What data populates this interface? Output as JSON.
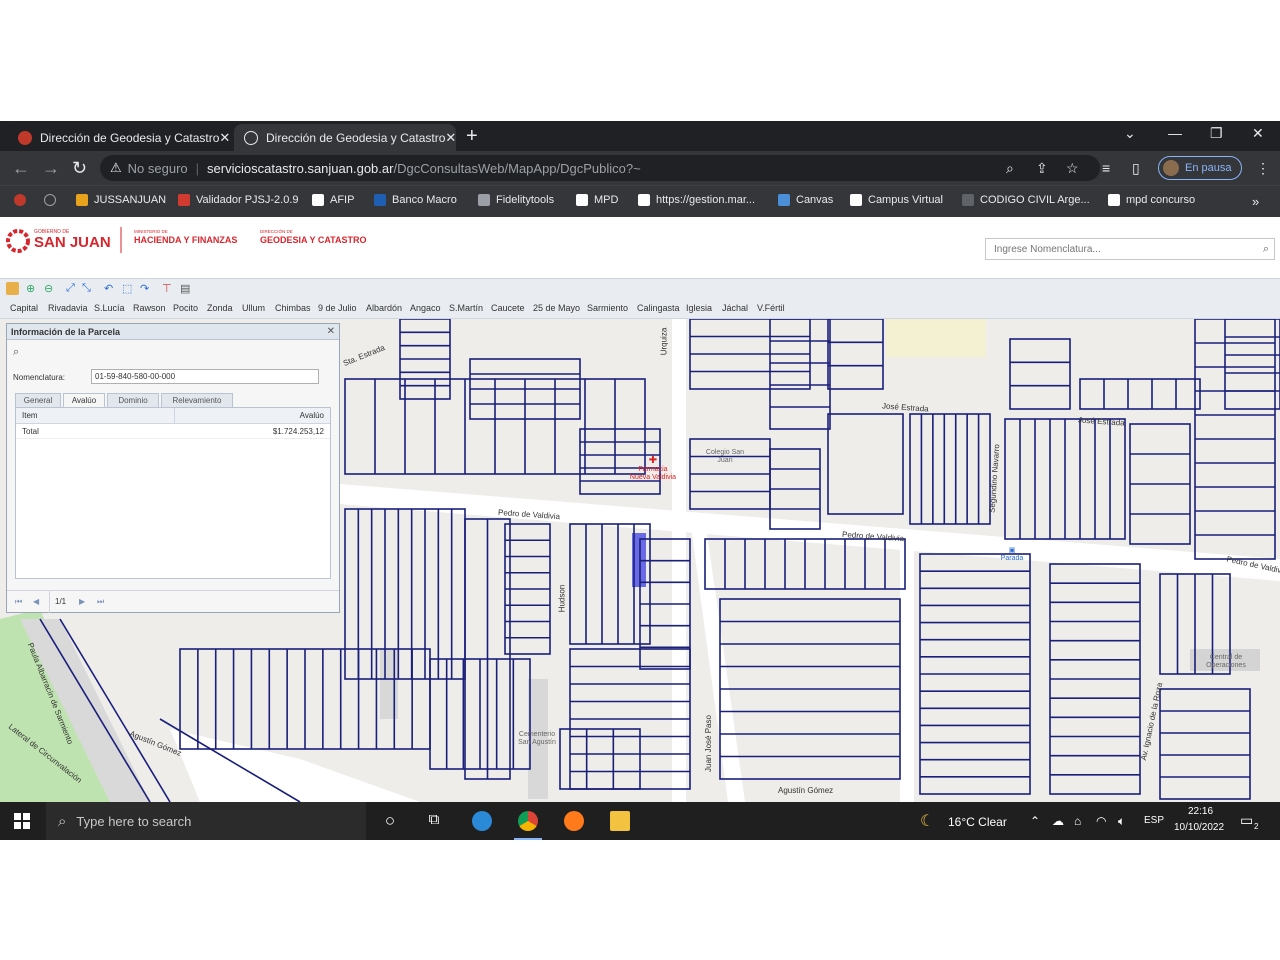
{
  "browser": {
    "tabs": [
      {
        "title": "Dirección de Geodesia y Catastro"
      },
      {
        "title": "Dirección de Geodesia y Catastro"
      }
    ],
    "address": {
      "security_label": "No seguro",
      "host": "servicioscatastro.sanjuan.gob.ar",
      "path": "/DgcConsultasWeb/MapApp/DgcPublico?~"
    },
    "profile_label": "En pausa",
    "bookmarks": [
      {
        "label": "JUSSANJUAN",
        "color": "#e8a21b"
      },
      {
        "label": "Validador PJSJ-2.0.9",
        "color": "#d23b2f"
      },
      {
        "label": "AFIP",
        "color": "#ffffff"
      },
      {
        "label": "Banco Macro",
        "color": "#1e5fb3"
      },
      {
        "label": "Fidelitytools",
        "color": "#9aa0a6"
      },
      {
        "label": "MPD",
        "color": "#ffffff"
      },
      {
        "label": "https://gestion.mar...",
        "color": "#ffffff"
      },
      {
        "label": "Canvas",
        "color": "#4a8fd8"
      },
      {
        "label": "Campus Virtual",
        "color": "#ffffff"
      },
      {
        "label": "CODIGO CIVIL Arge...",
        "color": "#5f6368"
      },
      {
        "label": "mpd concurso",
        "color": "#ffffff"
      }
    ]
  },
  "site": {
    "logo_gov_small": "GOBIERNO DE",
    "logo_gov": "SAN JUAN",
    "logo_ministry_small": "MINISTERIO DE",
    "logo_ministry": "HACIENDA Y FINANZAS",
    "logo_dir_small": "DIRECCIÓN DE",
    "logo_dir": "GEODESIA Y CATASTRO",
    "search_placeholder": "Ingrese Nomenclatura..."
  },
  "departments": [
    "Capital",
    "Rivadavia",
    "S.Lucía",
    "Rawson",
    "Pocito",
    "Zonda",
    "Ullum",
    "Chimbas",
    "9 de Julio",
    "Albardón",
    "Angaco",
    "S.Martín",
    "Caucete",
    "25 de Mayo",
    "Sarmiento",
    "Calingasta",
    "Iglesia",
    "Jáchal",
    "V.Fértil"
  ],
  "map": {
    "streets": [
      {
        "label": "Pedro de Valdivia"
      },
      {
        "label": "Pedro de Valdivia"
      },
      {
        "label": "Pedro de Valdivia"
      },
      {
        "label": "José Estrada"
      },
      {
        "label": "José Estrada"
      },
      {
        "label": "Agustín Gómez"
      },
      {
        "label": "Agustín Gómez"
      },
      {
        "label": "Juan José Paso"
      },
      {
        "label": "Segundino Navarro"
      },
      {
        "label": "Av. Ignacio de la Roza"
      },
      {
        "label": "Hudson"
      },
      {
        "label": "Urquiza"
      },
      {
        "label": "Sta. Estrada"
      },
      {
        "label": "Paula Albarracín de Sarmiento"
      },
      {
        "label": "Lateral de Circunvalación"
      }
    ],
    "places": [
      {
        "label": "Farmacia Nueva Valdivia"
      },
      {
        "label": "Parada"
      },
      {
        "label": "Central de Operaciones"
      },
      {
        "label": "Colegio San Juan"
      },
      {
        "label": "Cementerio San Agustín"
      }
    ]
  },
  "panel": {
    "title": "Información de la Parcela",
    "nomenclatura_label": "Nomenclatura:",
    "nomenclatura_value": "01-59-840-580-00-000",
    "tabs": [
      "General",
      "Avalúo",
      "Dominio",
      "Relevamiento"
    ],
    "active_tab": 1,
    "grid": {
      "columns": [
        "Item",
        "Avalúo"
      ],
      "rows": [
        {
          "item": "Total",
          "value": "$1.724.253,12"
        }
      ]
    },
    "pager": "1/1"
  },
  "taskbar": {
    "search_placeholder": "Type here to search",
    "weather": "16°C  Clear",
    "lang": "ESP",
    "time": "22:16",
    "date": "10/10/2022",
    "notif_count": "2"
  }
}
